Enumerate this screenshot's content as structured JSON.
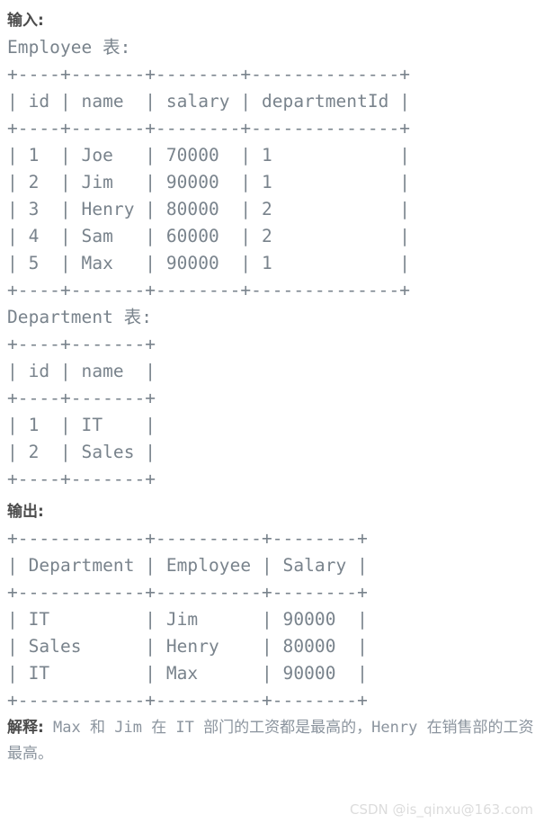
{
  "sections": {
    "input": {
      "heading": "输入:",
      "employee_table_label": "Employee 表:",
      "department_table_label": "Department 表:"
    },
    "output": {
      "heading": "输出:"
    }
  },
  "employee_table": {
    "columns": [
      "id",
      "name",
      "salary",
      "departmentId"
    ],
    "rows": [
      [
        "1",
        "Joe",
        "70000",
        "1"
      ],
      [
        "2",
        "Jim",
        "90000",
        "1"
      ],
      [
        "3",
        "Henry",
        "80000",
        "2"
      ],
      [
        "4",
        "Sam",
        "60000",
        "2"
      ],
      [
        "5",
        "Max",
        "90000",
        "1"
      ]
    ],
    "ascii": {
      "border": "+----+-------+--------+--------------+",
      "header": "| id | name  | salary | departmentId |",
      "rows": [
        "| 1  | Joe   | 70000  | 1            |",
        "| 2  | Jim   | 90000  | 1            |",
        "| 3  | Henry | 80000  | 2            |",
        "| 4  | Sam   | 60000  | 2            |",
        "| 5  | Max   | 90000  | 1            |"
      ]
    }
  },
  "department_table": {
    "columns": [
      "id",
      "name"
    ],
    "rows": [
      [
        "1",
        "IT"
      ],
      [
        "2",
        "Sales"
      ]
    ],
    "ascii": {
      "border": "+----+-------+",
      "header": "| id | name  |",
      "rows": [
        "| 1  | IT    |",
        "| 2  | Sales |"
      ]
    }
  },
  "output_table": {
    "columns": [
      "Department",
      "Employee",
      "Salary"
    ],
    "rows": [
      [
        "IT",
        "Jim",
        "90000"
      ],
      [
        "Sales",
        "Henry",
        "80000"
      ],
      [
        "IT",
        "Max",
        "90000"
      ]
    ],
    "ascii": {
      "border": "+------------+----------+--------+",
      "header": "| Department | Employee | Salary |",
      "rows": [
        "| IT         | Jim      | 90000  |",
        "| Sales      | Henry    | 80000  |",
        "| IT         | Max      | 90000  |"
      ]
    }
  },
  "explanation": {
    "lead": "解释:",
    "part1": " Max ",
    "part2": "和",
    "part3": " Jim ",
    "part4": "在",
    "part5": " IT ",
    "part6": "部门的工资都是最高的，",
    "part7": "Henry ",
    "part8": "在销售部的工资最高。",
    "full_text": "解释: Max 和 Jim 在 IT 部门的工资都是最高的，Henry 在销售部的工资最高。"
  },
  "watermark": {
    "text": "CSDN @is_qinxu@163.com"
  }
}
